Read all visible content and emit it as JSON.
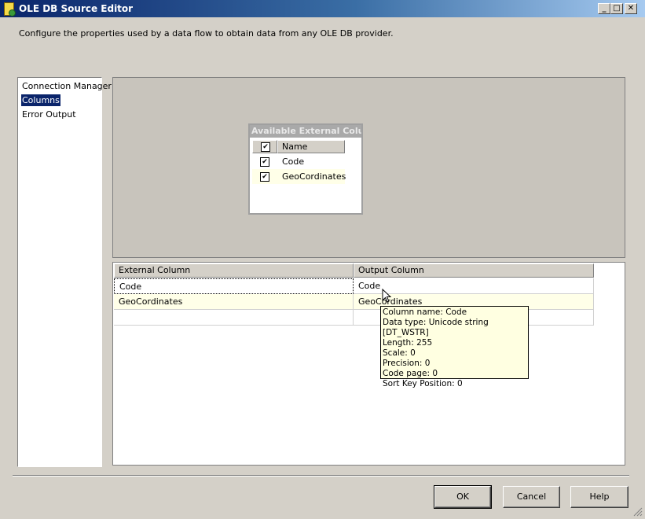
{
  "window": {
    "title": "OLE DB Source Editor",
    "min": "_",
    "max": "□",
    "close": "✕"
  },
  "description": "Configure the properties used by a data flow to obtain data from any OLE DB provider.",
  "nav": {
    "items": [
      "Connection Manager",
      "Columns",
      "Error Output"
    ],
    "selected": "Columns"
  },
  "available_columns": {
    "header": "Available External Colu...",
    "name_header": "Name",
    "rows": [
      {
        "name": "Code",
        "checked": true
      },
      {
        "name": "GeoCordinates",
        "checked": true
      }
    ]
  },
  "mapping_grid": {
    "headers": [
      "External Column",
      "Output Column"
    ],
    "rows": [
      [
        "Code",
        "Code"
      ],
      [
        "GeoCordinates",
        "GeoCordinates"
      ]
    ]
  },
  "tooltip": {
    "lines": [
      "Column name: Code",
      "Data type: Unicode string [DT_WSTR]",
      "Length: 255",
      "Scale: 0",
      "Precision: 0",
      "Code page: 0",
      "Sort Key Position: 0"
    ]
  },
  "buttons": {
    "ok": "OK",
    "cancel": "Cancel",
    "help": "Help"
  },
  "colors": {
    "title_start": "#0a246a",
    "selection": "#0a246a",
    "tooltip_bg": "#ffffe1",
    "alt_row": "#ffffe8"
  }
}
